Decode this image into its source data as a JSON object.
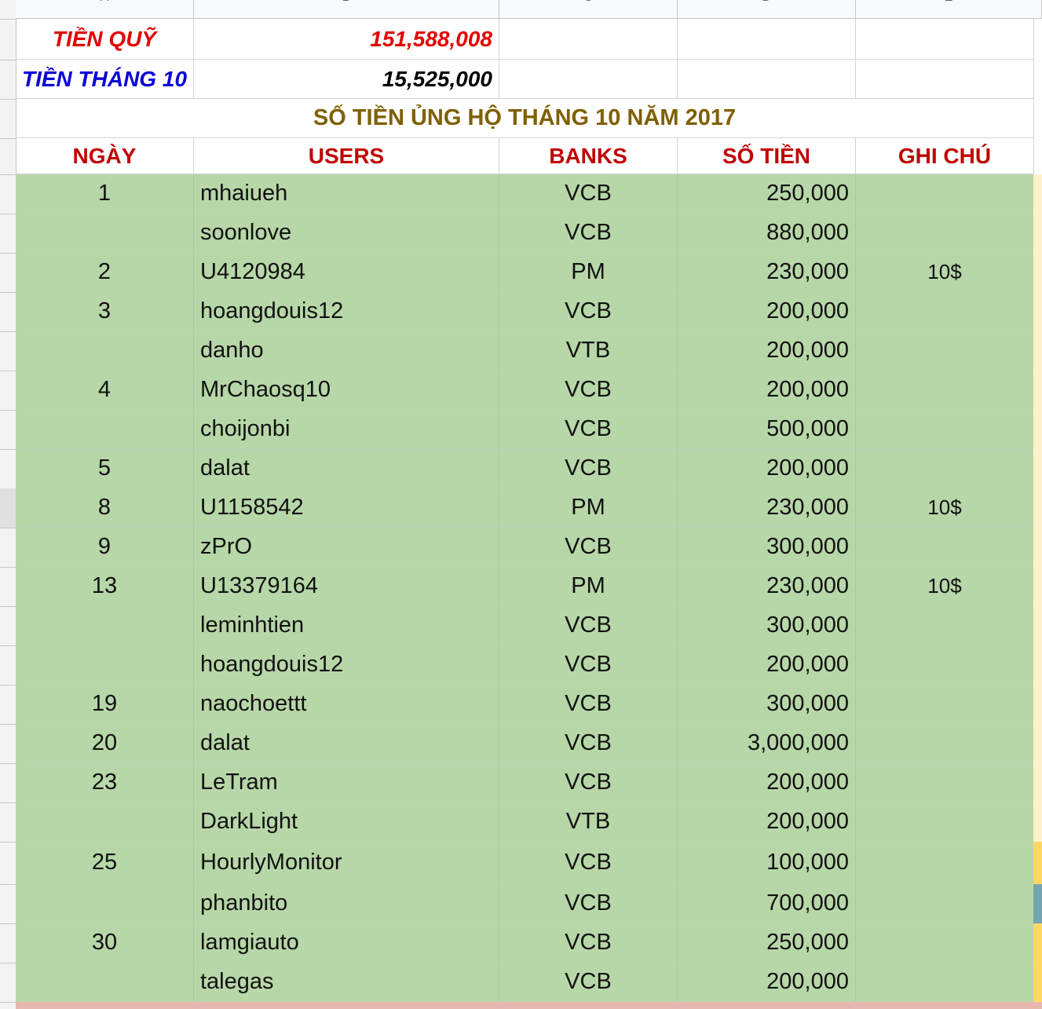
{
  "column_headers": [
    "A",
    "B",
    "C",
    "D",
    "E"
  ],
  "summary": {
    "fund_label": "TIỀN QUỸ",
    "fund_value": "151,588,008",
    "month_label": "TIỀN THÁNG 10",
    "month_value": "15,525,000"
  },
  "title": "SỐ TIỀN ỦNG HỘ THÁNG 10 NĂM 2017",
  "table_headers": [
    "NGÀY",
    "USERS",
    "BANKS",
    "SỐ TIỀN",
    "GHI CHÚ"
  ],
  "rows": [
    {
      "day": "1",
      "user": "mhaiueh",
      "bank": "VCB",
      "amount": "250,000",
      "note": ""
    },
    {
      "day": "",
      "user": "soonlove",
      "bank": "VCB",
      "amount": "880,000",
      "note": ""
    },
    {
      "day": "2",
      "user": "U4120984",
      "bank": "PM",
      "amount": "230,000",
      "note": "10$"
    },
    {
      "day": "3",
      "user": "hoangdouis12",
      "bank": "VCB",
      "amount": "200,000",
      "note": ""
    },
    {
      "day": "",
      "user": "danho",
      "bank": "VTB",
      "amount": "200,000",
      "note": ""
    },
    {
      "day": "4",
      "user": "MrChaosq10",
      "bank": "VCB",
      "amount": "200,000",
      "note": ""
    },
    {
      "day": "",
      "user": "choijonbi",
      "bank": "VCB",
      "amount": "500,000",
      "note": ""
    },
    {
      "day": "5",
      "user": "dalat",
      "bank": "VCB",
      "amount": "200,000",
      "note": ""
    },
    {
      "day": "8",
      "user": "U1158542",
      "bank": "PM",
      "amount": "230,000",
      "note": "10$"
    },
    {
      "day": "9",
      "user": "zPrO",
      "bank": "VCB",
      "amount": "300,000",
      "note": ""
    },
    {
      "day": "13",
      "user": "U13379164",
      "bank": "PM",
      "amount": "230,000",
      "note": "10$"
    },
    {
      "day": "",
      "user": "leminhtien",
      "bank": "VCB",
      "amount": "300,000",
      "note": ""
    },
    {
      "day": "",
      "user": "hoangdouis12",
      "bank": "VCB",
      "amount": "200,000",
      "note": ""
    },
    {
      "day": "19",
      "user": "naochoettt",
      "bank": "VCB",
      "amount": "300,000",
      "note": ""
    },
    {
      "day": "20",
      "user": "dalat",
      "bank": "VCB",
      "amount": "3,000,000",
      "note": ""
    },
    {
      "day": "23",
      "user": "LeTram",
      "bank": "VCB",
      "amount": "200,000",
      "note": ""
    },
    {
      "day": "",
      "user": "DarkLight",
      "bank": "VTB",
      "amount": "200,000",
      "note": ""
    },
    {
      "day": "25",
      "user": "HourlyMonitor",
      "bank": "VCB",
      "amount": "100,000",
      "note": ""
    },
    {
      "day": "",
      "user": "phanbito",
      "bank": "VCB",
      "amount": "700,000",
      "note": ""
    },
    {
      "day": "30",
      "user": "lamgiauto",
      "bank": "VCB",
      "amount": "250,000",
      "note": ""
    },
    {
      "day": "",
      "user": "talegas",
      "bank": "VCB",
      "amount": "200,000",
      "note": ""
    }
  ],
  "colors": {
    "row_fill": "#b7d7a8",
    "header_red": "#c00000",
    "title_gold": "#7f6000",
    "fund_red": "#e30000",
    "month_blue": "#0b00d6"
  }
}
